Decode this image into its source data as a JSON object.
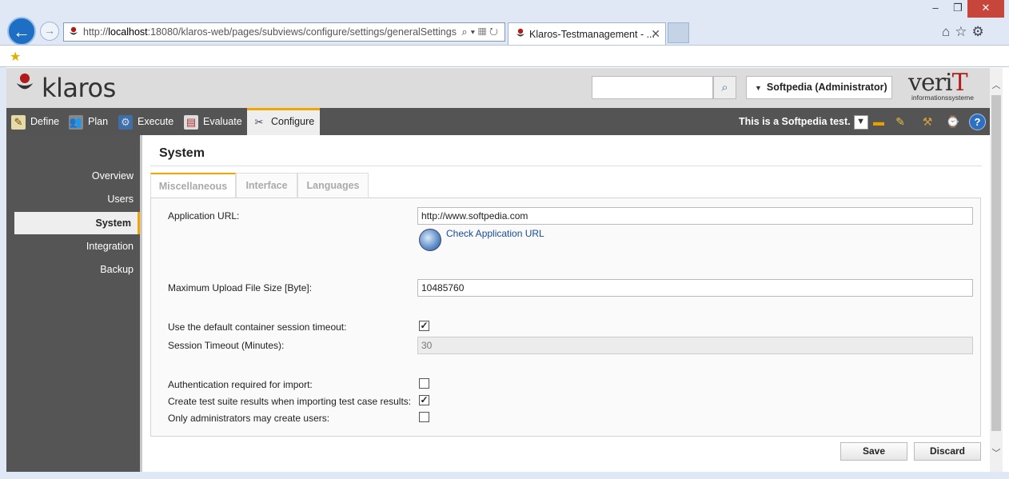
{
  "browser": {
    "url_prefix": "http://",
    "url_host": "localhost",
    "url_rest": ":18080/klaros-web/pages/subviews/configure/settings/generalSettings",
    "tab_title": "Klaros-Testmanagement - ...",
    "window_controls": {
      "minimize": "–",
      "restore": "❐",
      "close": "✕"
    }
  },
  "header": {
    "logo_text": "klaros",
    "search_placeholder": "",
    "user_label": "Softpedia (Administrator)",
    "brand_main": "veri",
    "brand_t": "T",
    "brand_sub": "informationssysteme"
  },
  "nav": {
    "items": [
      {
        "label": "Define",
        "icon": "pencil-icon"
      },
      {
        "label": "Plan",
        "icon": "people-icon"
      },
      {
        "label": "Execute",
        "icon": "gear-icon"
      },
      {
        "label": "Evaluate",
        "icon": "report-icon"
      },
      {
        "label": "Configure",
        "icon": "tools-icon"
      }
    ],
    "active": "Configure",
    "project_label": "This is a Softpedia test."
  },
  "sidebar": {
    "items": [
      {
        "label": "Overview"
      },
      {
        "label": "Users"
      },
      {
        "label": "System"
      },
      {
        "label": "Integration"
      },
      {
        "label": "Backup"
      }
    ],
    "active": "System"
  },
  "main": {
    "title": "System",
    "tabs": [
      {
        "label": "Miscellaneous"
      },
      {
        "label": "Interface"
      },
      {
        "label": "Languages"
      }
    ],
    "active_tab": "Miscellaneous",
    "fields": {
      "app_url_label": "Application URL:",
      "app_url_value": "http://www.softpedia.com",
      "check_url_link": "Check Application URL",
      "max_upload_label": "Maximum Upload File Size [Byte]:",
      "max_upload_value": "10485760",
      "default_timeout_label": "Use the default container session timeout:",
      "default_timeout_checked": true,
      "session_timeout_label": "Session Timeout (Minutes):",
      "session_timeout_value": "30",
      "auth_import_label": "Authentication required for import:",
      "auth_import_checked": false,
      "create_suite_label": "Create test suite results when importing test case results:",
      "create_suite_checked": true,
      "only_admins_label": "Only administrators may create users:",
      "only_admins_checked": false
    },
    "save_label": "Save",
    "discard_label": "Discard"
  }
}
